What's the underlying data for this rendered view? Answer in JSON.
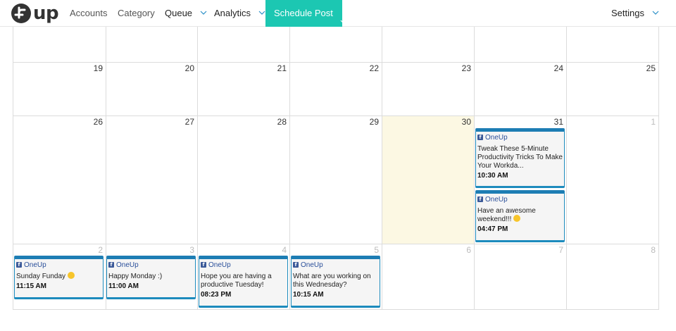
{
  "nav": {
    "logo_text": "up",
    "accounts": "Accounts",
    "category": "Category",
    "queue": "Queue",
    "analytics": "Analytics",
    "schedule_post": "Schedule Post",
    "settings": "Settings",
    "accent_color": "#1cc7b2"
  },
  "calendar": {
    "weeks": [
      {
        "days": [
          "",
          "",
          "",
          "",
          "",
          "",
          ""
        ]
      },
      {
        "days": [
          "19",
          "20",
          "21",
          "22",
          "23",
          "24",
          "25"
        ]
      },
      {
        "days": [
          "26",
          "27",
          "28",
          "29",
          "30",
          "31",
          "1"
        ]
      },
      {
        "days": [
          "2",
          "3",
          "4",
          "5",
          "6",
          "7",
          "8"
        ]
      }
    ],
    "today_color": "#fcf8e3"
  },
  "posts": [
    {
      "account": "OneUp",
      "text": "Tweak These 5-Minute Productivity Tricks To Make Your Workda...",
      "time": "10:30 AM"
    },
    {
      "account": "OneUp",
      "text": "Have an awesome weekend!!!",
      "time": "04:47 PM"
    },
    {
      "account": "OneUp",
      "text": "Sunday Funday",
      "time": "11:15 AM"
    },
    {
      "account": "OneUp",
      "text": "Happy Monday :)",
      "time": "11:00 AM"
    },
    {
      "account": "OneUp",
      "text": "Hope you are having a productive Tuesday!",
      "time": "08:23 PM"
    },
    {
      "account": "OneUp",
      "text": "What are you working on this Wednesday?",
      "time": "10:15 AM"
    }
  ]
}
